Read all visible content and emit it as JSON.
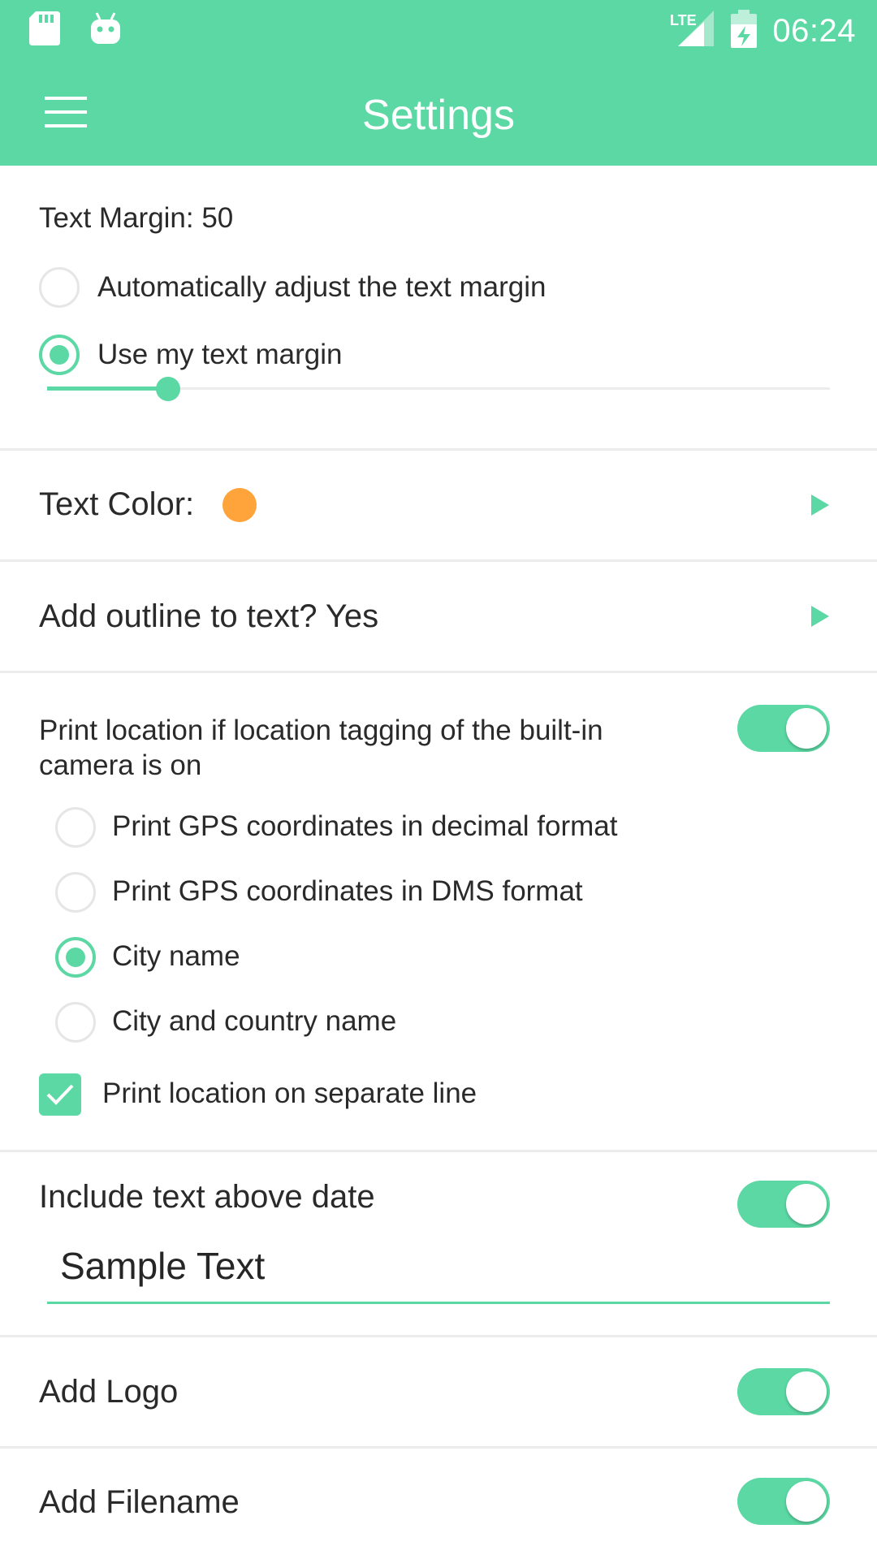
{
  "status_bar": {
    "time": "06:24",
    "network": "LTE",
    "icons": [
      "sd-card-icon",
      "android-icon",
      "signal-icon",
      "battery-icon"
    ]
  },
  "app_bar": {
    "title": "Settings",
    "menu_icon": "hamburger-menu-icon"
  },
  "text_margin": {
    "label": "Text Margin: 50",
    "value": 50,
    "options": [
      {
        "label": "Automatically adjust the text margin",
        "selected": false
      },
      {
        "label": "Use my text margin",
        "selected": true
      }
    ],
    "slider_fraction": 0.155
  },
  "text_color": {
    "label": "Text Color:",
    "swatch_color": "#ffa43a"
  },
  "outline": {
    "label": "Add outline to text? Yes"
  },
  "location": {
    "label": "Print location if location tagging of the built-in camera is on",
    "enabled": true,
    "options": [
      {
        "label": "Print GPS coordinates in decimal format",
        "selected": false
      },
      {
        "label": "Print GPS coordinates in DMS format",
        "selected": false
      },
      {
        "label": "City name",
        "selected": true
      },
      {
        "label": "City and country name",
        "selected": false
      }
    ],
    "separate_line": {
      "label": "Print location on separate line",
      "checked": true
    }
  },
  "text_above_date": {
    "label": "Include text above date",
    "enabled": true,
    "value": "Sample Text"
  },
  "logo": {
    "label": "Add Logo",
    "enabled": true
  },
  "filename": {
    "label": "Add Filename",
    "enabled": true
  },
  "colors": {
    "accent": "#5bd8a3",
    "divider": "#ececec",
    "radio_border": "#e6e6e6"
  }
}
